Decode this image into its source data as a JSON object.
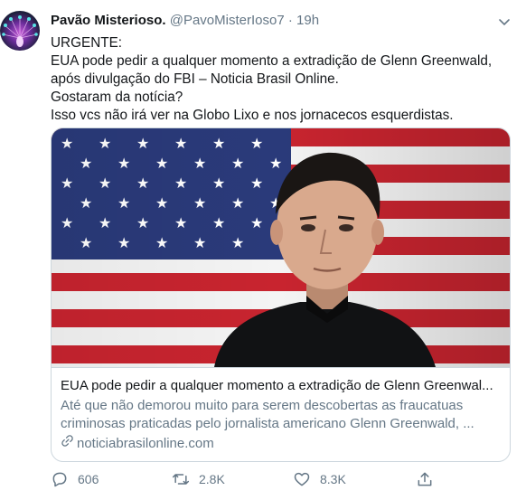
{
  "tweet": {
    "author_name": "Pavão Misterioso.",
    "handle": "@PavoMisterIoso7",
    "separator": "·",
    "time": "19h",
    "lines": [
      "URGENTE:",
      "EUA pode pedir a qualquer momento a extradição de Glenn Greenwald,",
      "após divulgação do FBI – Noticia Brasil Online.",
      "Gostaram da notícia?",
      "Isso vcs não irá ver na Globo Lixo e nos jornacecos esquerdistas."
    ]
  },
  "card": {
    "title": "EUA pode pedir a qualquer momento a extradição de Glenn Greenwal...",
    "description_lines": [
      "Até que não demorou muito para serem descobertas as fraucatuas",
      "criminosas praticadas pelo jornalista americano Glenn Greenwald, ..."
    ],
    "domain": "noticiabrasilonline.com"
  },
  "actions": {
    "replies": "606",
    "retweets": "2.8K",
    "likes": "8.3K"
  },
  "colors": {
    "text": "#14171a",
    "secondary": "#657786",
    "border": "#ccd6dd"
  }
}
